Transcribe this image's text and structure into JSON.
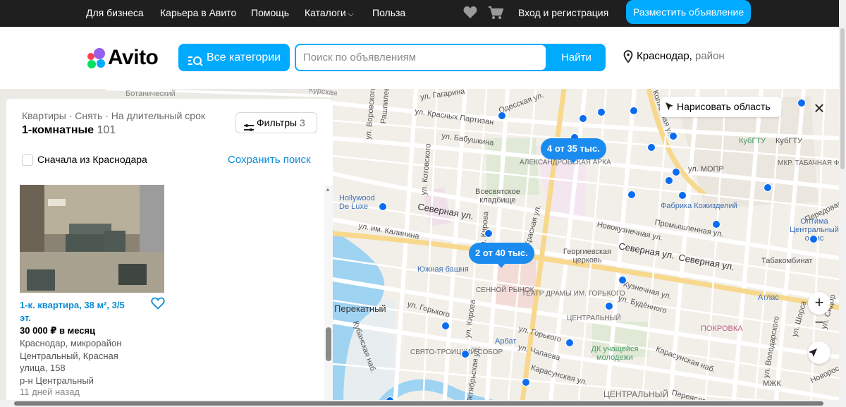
{
  "topbar": {
    "for_business": "Для бизнеса",
    "career": "Карьера в Авито",
    "help": "Помощь",
    "catalogs": "Каталоги",
    "benefit": "Польза",
    "login": "Вход и регистрация",
    "post_ad": "Разместить объявление"
  },
  "header": {
    "logo": "Avito",
    "all_categories": "Все категории",
    "search_placeholder": "Поиск по объявлениям",
    "search_button": "Найти",
    "location_city": "Краснодар,",
    "location_area": "район"
  },
  "panel": {
    "breadcrumbs": "Квартиры · Снять · На длительный срок",
    "title": "1-комнатные",
    "count": "101",
    "filters_label": "Фильтры",
    "filters_count": "3",
    "checkbox_label": "Сначала из Краснодара",
    "save_search": "Сохранить поиск"
  },
  "listing": {
    "title": "1-к. квартира, 38 м², 3/5 эт.",
    "price": "30 000 ₽ в месяц",
    "address_lines": [
      "Краснодар, микрорайон",
      "Центральный, Красная",
      "улица, 158",
      "р-н Центральный"
    ],
    "age": "11 дней назад"
  },
  "map": {
    "draw_area": "Нарисовать область",
    "zoom_in": "+",
    "zoom_out": "−",
    "clusters": [
      "4 от 35 тыс.",
      "2 от 40 тыс."
    ],
    "labels": {
      "botanical": "Ботанический",
      "gagarina": "ул. Гагарина",
      "odesskaya": "Одесская ул.",
      "vorovskogo": "ул. Воровского",
      "krasnykh_partizan": "ул. Красных Партизан",
      "babushkina": "ул. Бабушкина",
      "kotovskogo": "ул. Котовского",
      "kolkhoznaya": "Колхозная ул.",
      "kubgtu1": "КубГТУ",
      "kubgtu2": "КубГТУ",
      "arch": "АЛЕКСАНДРОВСКАЯ АРКА",
      "mopr": "ул. МОПР",
      "tobacco": "МКР. ТАБАЧНАЯ ФАБРИКА",
      "vsesvyat": "Всесвятское кладбище",
      "hollywood": "Hollywood De Luxe",
      "severnaya": "Северная ул.",
      "kozh": "Фабрика Кожизделий",
      "peredovaya": "Передовая",
      "kalinina": "ул. им. Калинина",
      "kirova": "ул. Кирова",
      "krasnaya": "Красная ул.",
      "novokuznechnaya": "Новокузнечная ул.",
      "promyshlennaya": "Промышленная ул.",
      "optima": "Оптима Центральный офис",
      "georg": "Георгиевская церковь",
      "severnaya2": "Северная ул.",
      "severnaya3": "Северная ул.",
      "tabak": "Табакомбинат",
      "yuzh": "Южная башня",
      "senoy": "СЕННОЙ РЫНОК",
      "theatre": "ТЕАТР ДРАМЫ ИМ. ГОРЬКОГО",
      "kuznechnaya": "Кузнечная ул.",
      "budennogo": "ул. Будённого",
      "atlas": "Атлас",
      "perekatny": "Перекатный",
      "gorkogo": "ул. Горького",
      "central_area": "ЦЕНТРАЛЬНЫЙ",
      "pokrovka": "ПОКРОВКА",
      "gorkogo2": "ул. Горького",
      "arbat": "Арбат",
      "chapaeva": "ул. Чапаева",
      "dk": "ДК учащейся молодежи",
      "karasunskaya": "Карасунская наб.",
      "volodarskogo": "ул. Володарского",
      "shora": "ул. Шорса",
      "sidorova": "ул. Сидор",
      "novorossiyskaya": "Новоросс",
      "mzhk": "МЖК",
      "sobor": "СВЯТО-ТРОИЦКИЙ СОБОР",
      "karasunskaya_st": "Карасунская ул.",
      "oktyabrskaya": "Октябрьская ул.",
      "kubanskaya": "Кубанская наб.",
      "central2": "ЦЕНТРАЛЬНЫЙ",
      "pereyaslav": "Переяслав",
      "kirova_vert": "ул. Кирова",
      "kurskaya": "Курская",
      "rashpil": "Рашпилевская"
    }
  },
  "colors": {
    "accent": "#00aaff",
    "pin": "#0a6cf0",
    "link": "#0a8ad6",
    "topbar": "#1f1f1f"
  },
  "icons": [
    "heart-icon",
    "cart-icon",
    "search-icon",
    "location-pin-icon",
    "filter-icon",
    "cursor-icon",
    "close-icon",
    "navigate-arrow-icon"
  ]
}
